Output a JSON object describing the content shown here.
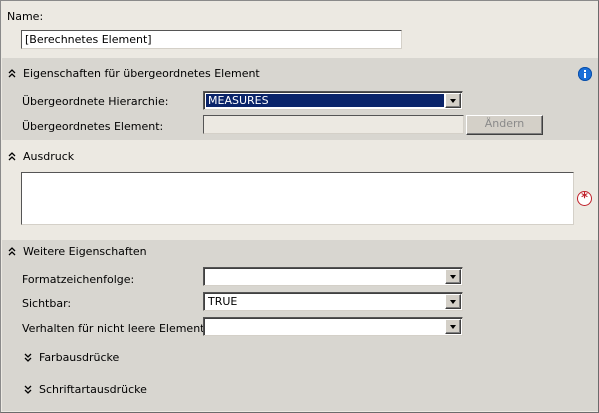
{
  "name": {
    "label": "Name:",
    "value": "[Berechnetes Element]"
  },
  "parent_section": {
    "title": "Eigenschaften für übergeordnetes Element",
    "hierarchy_label": "Übergeordnete Hierarchie:",
    "hierarchy_value": "MEASURES",
    "element_label": "Übergeordnetes Element:",
    "element_value": "",
    "change_button": "Ändern"
  },
  "expression_section": {
    "title": "Ausdruck",
    "value": ""
  },
  "more_section": {
    "title": "Weitere Eigenschaften",
    "format_label": "Formatzeichenfolge:",
    "format_value": "",
    "visible_label": "Sichtbar:",
    "visible_value": "TRUE",
    "nonempty_label": "Verhalten für nicht leere Elemente:",
    "nonempty_value": "",
    "color_expr": "Farbausdrücke",
    "font_expr": "Schriftartausdrücke"
  },
  "icons": {
    "info": "info-icon",
    "required": "required-icon"
  }
}
